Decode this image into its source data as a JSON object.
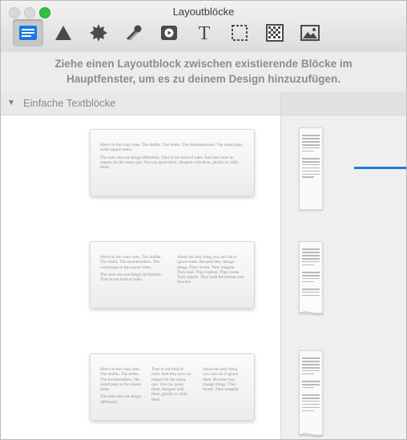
{
  "window": {
    "title": "Layoutblöcke"
  },
  "toolbar": {
    "items": [
      {
        "icon": "text-block-icon",
        "active": true
      },
      {
        "icon": "triangle-shape-icon",
        "active": false
      },
      {
        "icon": "starburst-icon",
        "active": false
      },
      {
        "icon": "shooting-star-icon",
        "active": false
      },
      {
        "icon": "video-play-icon",
        "active": false
      },
      {
        "icon": "text-T-icon",
        "active": false
      },
      {
        "icon": "selection-frame-icon",
        "active": false
      },
      {
        "icon": "texture-pattern-icon",
        "active": false
      },
      {
        "icon": "image-icon",
        "active": false
      }
    ]
  },
  "description": {
    "line1": "Ziehe einen Layoutblock zwischen existierende Blöcke im",
    "line2": "Hauptfenster, um es zu deinem Design hinzuzufügen."
  },
  "section": {
    "label": "Einfache Textblöcke",
    "expanded": true
  },
  "colors": {
    "accent": "#1f7ad9",
    "active_tool_bg": "#c7c7c7"
  },
  "cards": {
    "one": {
      "p1": "Here's to the crazy ones. The misfits. The rebels. The troublema-kers. The round pegs in the square holes.",
      "p2": "The ones who see things differently. They're not fond of rules. And they have no respect for the status quo. You can quote them, disagree with them, glorify or vilify them."
    },
    "two": {
      "c1p1": "Here's to the crazy ones. The misfits. The rebels. The troublemakers. The round pegs in the square holes.",
      "c1p2": "The ones who see things dif-ferently. They're not fond of rules.",
      "c2p1": "About the only thing you can't do is ignore them. Because they change things. They invent. They imagine. They heal. They explore. They create. They inspire. They push the human race forward."
    },
    "three": {
      "c1p1": "Here's to the crazy ones. The misfits. The rebels. The troublemakers. The round pegs in the square holes.",
      "c1p2": "The ones who see things differently.",
      "c2p1": "They're not fond of rules. And they have no respect for the status quo. You can quote them, disagree with them, glorify or vilify them.",
      "c3p1": "About the only thing you can't do is ignore them. Because they change things. They invent. They imagine."
    }
  }
}
